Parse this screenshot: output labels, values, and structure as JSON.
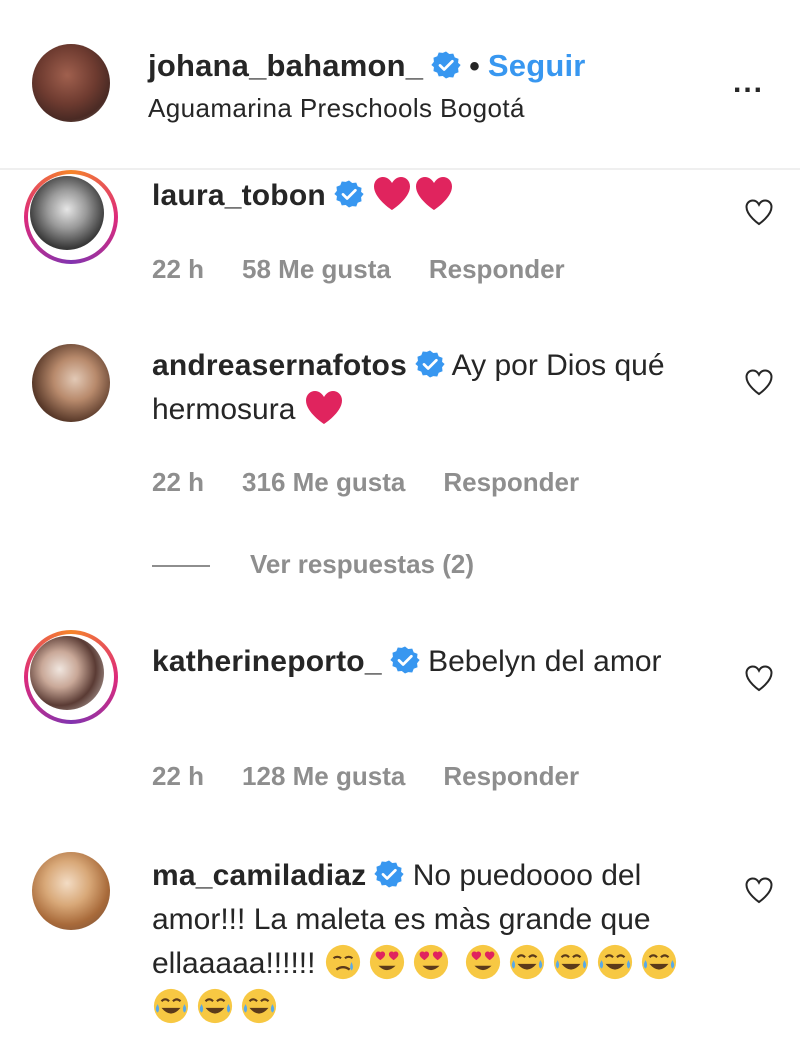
{
  "header": {
    "username": "johana_bahamon_",
    "separator": "•",
    "follow_label": "Seguir",
    "location": "Aguamarina Preschools Bogotá",
    "more_label": "..."
  },
  "comments": [
    {
      "username": "laura_tobon",
      "text": "",
      "time": "22 h",
      "likes": "58 Me gusta",
      "reply_label": "Responder"
    },
    {
      "username": "andreasernafotos",
      "text": "Ay por Dios qué hermosura",
      "time": "22 h",
      "likes": "316 Me gusta",
      "reply_label": "Responder"
    },
    {
      "username": "katherineporto_",
      "text": "Bebelyn del amor",
      "time": "22 h",
      "likes": "128 Me gusta",
      "reply_label": "Responder"
    },
    {
      "username": "ma_camiladiaz",
      "text": "No puedoooo del amor!!! La maleta es màs grande que ellaaaaa!!!!!!",
      "time": "",
      "likes": "",
      "reply_label": ""
    }
  ],
  "view_replies": "Ver respuestas (2)",
  "colors": {
    "accent": "#3897f0",
    "verified": "#3897f0",
    "meta": "#8e8e8e",
    "text": "#262626",
    "emoji_heart": "#e0245e"
  },
  "icons": [
    "verified-badge-icon",
    "heart-outline-icon",
    "red-heart-emoji",
    "weary-face-emoji",
    "heart-eyes-emoji",
    "tears-of-joy-emoji"
  ]
}
